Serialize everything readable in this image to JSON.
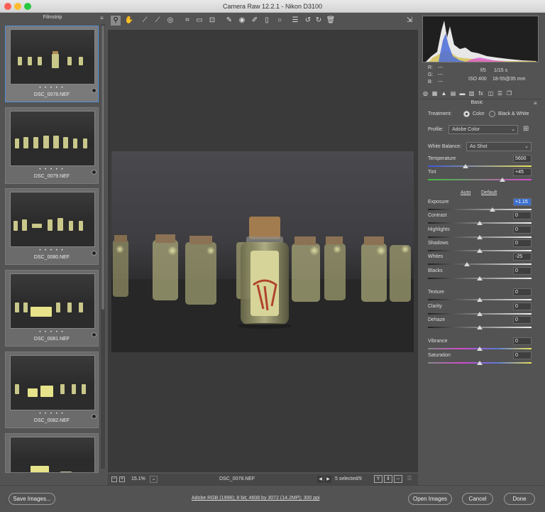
{
  "window": {
    "title": "Camera Raw 12.2.1  -  Nikon D3100"
  },
  "filmstrip": {
    "header": "Filmstrip",
    "items": [
      {
        "name": "DSC_0078.NEF",
        "rating": "• • • • •",
        "selected": true
      },
      {
        "name": "DSC_0079.NEF",
        "rating": "• • • • •",
        "selected": false
      },
      {
        "name": "DSC_0080.NEF",
        "rating": "• • • • •",
        "selected": false
      },
      {
        "name": "DSC_0081.NEF",
        "rating": "• • • • •",
        "selected": false
      },
      {
        "name": "DSC_0082.NEF",
        "rating": "• • • • •",
        "selected": false
      }
    ]
  },
  "toolbar": {
    "icons": [
      "zoom-icon",
      "hand-icon",
      "white-balance-icon",
      "color-sampler-icon",
      "target-adjust-icon",
      "crop-icon",
      "straighten-icon",
      "transform-icon",
      "spot-removal-icon",
      "red-eye-icon",
      "adjustment-brush-icon",
      "graduated-filter-icon",
      "radial-filter-icon",
      "preferences-icon",
      "rotate-ccw-icon",
      "rotate-cw-icon",
      "trash-icon",
      "full-screen-icon"
    ]
  },
  "status": {
    "zoom": "15.1%",
    "filename": "DSC_0078.NEF",
    "selection": "5 selected/9"
  },
  "readout": {
    "r": "R:",
    "g": "G:",
    "b": "B:",
    "r_val": "---",
    "g_val": "---",
    "b_val": "---",
    "aperture": "f/5",
    "shutter": "1/15 s",
    "iso": "ISO 400",
    "lens": "18-55@35 mm"
  },
  "panel": {
    "title": "Basic",
    "treatment_label": "Treatment:",
    "treatment_color": "Color",
    "treatment_bw": "Black & White",
    "profile_label": "Profile:",
    "profile_value": "Adobe Color",
    "wb_label": "White Balance:",
    "wb_value": "As Shot",
    "auto": "Auto",
    "default": "Default",
    "sliders": [
      {
        "label": "Temperature",
        "value": "5600",
        "pos": 0.36
      },
      {
        "label": "Tint",
        "value": "+45",
        "pos": 0.72
      },
      {
        "label": "Exposure",
        "value": "+1.15",
        "pos": 0.62
      },
      {
        "label": "Contrast",
        "value": "0",
        "pos": 0.5
      },
      {
        "label": "Highlights",
        "value": "0",
        "pos": 0.5
      },
      {
        "label": "Shadows",
        "value": "0",
        "pos": 0.5
      },
      {
        "label": "Whites",
        "value": "-25",
        "pos": 0.375
      },
      {
        "label": "Blacks",
        "value": "0",
        "pos": 0.5
      },
      {
        "label": "Texture",
        "value": "0",
        "pos": 0.5
      },
      {
        "label": "Clarity",
        "value": "0",
        "pos": 0.5
      },
      {
        "label": "Dehaze",
        "value": "0",
        "pos": 0.5
      },
      {
        "label": "Vibrance",
        "value": "0",
        "pos": 0.5
      },
      {
        "label": "Saturation",
        "value": "0",
        "pos": 0.5
      }
    ]
  },
  "bottom": {
    "save": "Save Images...",
    "info": "Adobe RGB (1998); 8 bit; 4608 by 3072 (14.2MP); 300 ppi",
    "open": "Open Images",
    "cancel": "Cancel",
    "done": "Done"
  },
  "colors": {
    "accent": "#4e8fd9",
    "exposure_highlight": "#3b6fd0"
  }
}
